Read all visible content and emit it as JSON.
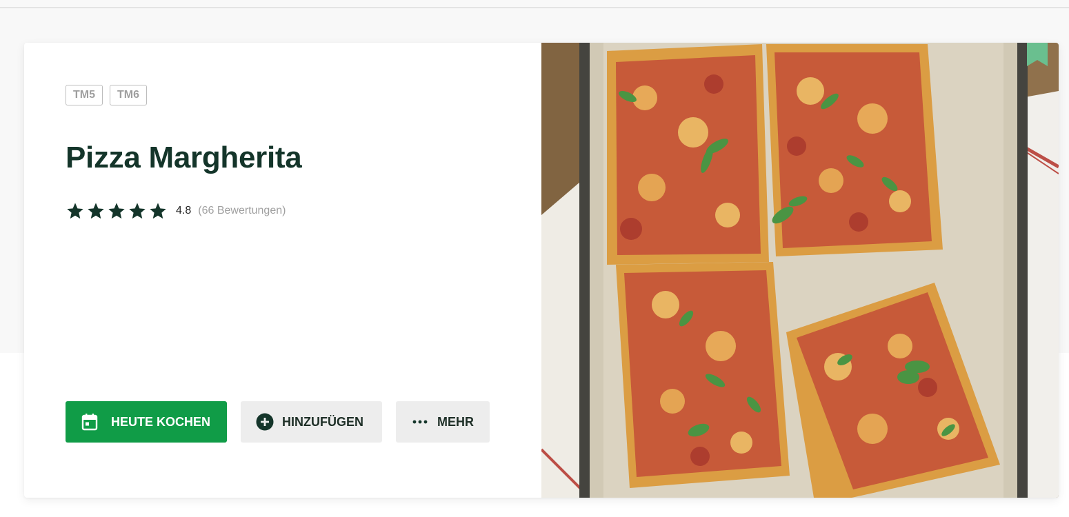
{
  "recipe": {
    "tags": [
      "TM5",
      "TM6"
    ],
    "title": "Pizza Margherita",
    "rating": {
      "stars": 5,
      "value": "4.8",
      "count": "(66 Bewertungen)"
    },
    "image_icon": "pizza-margherita-photo"
  },
  "actions": {
    "cook_today": {
      "label": "HEUTE KOCHEN",
      "icon": "calendar-icon"
    },
    "add": {
      "label": "HINZUFÜGEN",
      "icon": "plus-circle-icon"
    },
    "more": {
      "label": "MEHR",
      "icon": "more-dots-icon"
    }
  },
  "bookmark": {
    "icon": "bookmark-icon",
    "color": "#6abf8f"
  },
  "colors": {
    "primary": "#109c47",
    "title": "#14352a",
    "secondary_button": "#ededed"
  }
}
